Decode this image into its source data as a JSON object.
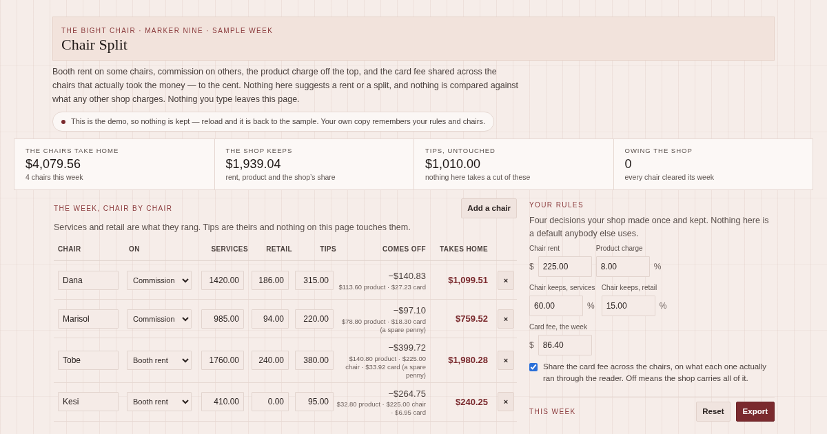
{
  "header": {
    "eyebrow": "THE BIGHT CHAIR · MARKER NINE · SAMPLE WEEK",
    "title": "Chair Split"
  },
  "intro": "Booth rent on some chairs, commission on others, the product charge off the top, and the card fee shared across the chairs that actually took the money — to the cent. Nothing here suggests a rent or a split, and nothing is compared against what any other shop charges. Nothing you type leaves this page.",
  "notice": "This is the demo, so nothing is kept — reload and it is back to the sample. Your own copy remembers your rules and chairs.",
  "stats": [
    {
      "label": "THE CHAIRS TAKE HOME",
      "value": "$4,079.56",
      "note": "4 chairs this week"
    },
    {
      "label": "THE SHOP KEEPS",
      "value": "$1,939.04",
      "note": "rent, product and the shop’s share"
    },
    {
      "label": "TIPS, UNTOUCHED",
      "value": "$1,010.00",
      "note": "nothing here takes a cut of these"
    },
    {
      "label": "OWING THE SHOP",
      "value": "0",
      "note": "every chair cleared its week"
    }
  ],
  "week": {
    "heading": "THE WEEK, CHAIR BY CHAIR",
    "add_button": "Add a chair",
    "description": "Services and retail are what they rang. Tips are theirs and nothing on this page touches them.",
    "columns": [
      "CHAIR",
      "ON",
      "SERVICES",
      "RETAIL",
      "TIPS",
      "COMES OFF",
      "TAKES HOME"
    ],
    "rows": [
      {
        "name": "Dana",
        "plan": "Commission",
        "services": "1420.00",
        "retail": "186.00",
        "tips": "315.00",
        "comes_off": "−$140.83",
        "detail": "$113.60 product · $27.23 card",
        "takes_home": "$1,099.51",
        "remove": "×"
      },
      {
        "name": "Marisol",
        "plan": "Commission",
        "services": "985.00",
        "retail": "94.00",
        "tips": "220.00",
        "comes_off": "−$97.10",
        "detail": "$78.80 product · $18.30 card (a spare penny)",
        "takes_home": "$759.52",
        "remove": "×"
      },
      {
        "name": "Tobe",
        "plan": "Booth rent",
        "services": "1760.00",
        "retail": "240.00",
        "tips": "380.00",
        "comes_off": "−$399.72",
        "detail": "$140.80 product · $225.00 chair · $33.92 card (a spare penny)",
        "takes_home": "$1,980.28",
        "remove": "×"
      },
      {
        "name": "Kesi",
        "plan": "Booth rent",
        "services": "410.00",
        "retail": "0.00",
        "tips": "95.00",
        "comes_off": "−$264.75",
        "detail": "$32.80 product · $225.00 chair · $6.95 card",
        "takes_home": "$240.25",
        "remove": "×"
      }
    ]
  },
  "rules": {
    "heading": "YOUR RULES",
    "description": "Four decisions your shop made once and kept. Nothing here is a default anybody else uses.",
    "field_rows": [
      [
        {
          "label": "Chair rent",
          "prefix": "$",
          "value": "225.00"
        },
        {
          "label": "Product charge",
          "value": "8.00",
          "suffix": "%"
        }
      ],
      [
        {
          "label": "Chair keeps, services",
          "value": "60.00",
          "suffix": "%"
        },
        {
          "label": "Chair keeps, retail",
          "value": "15.00",
          "suffix": "%"
        }
      ],
      [
        {
          "label": "Card fee, the week",
          "prefix": "$",
          "value": "86.40"
        }
      ]
    ],
    "share": {
      "checked": true,
      "label": "Share the card fee across the chairs, on what each one actually ran through the reader. Off means the shop carries all of it."
    }
  },
  "this_week": {
    "heading": "THIS WEEK",
    "buttons": [
      {
        "label": "Reset",
        "kind": "secondary"
      },
      {
        "label": "Export",
        "kind": "primary"
      }
    ]
  }
}
